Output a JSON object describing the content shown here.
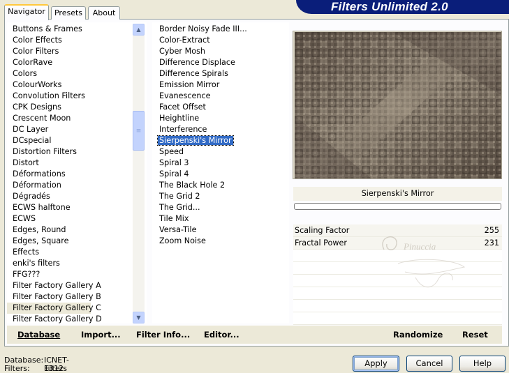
{
  "app": {
    "title": "Filters Unlimited 2.0"
  },
  "tabs": [
    {
      "label": "Navigator"
    },
    {
      "label": "Presets"
    },
    {
      "label": "About"
    }
  ],
  "categories": [
    "Buttons & Frames",
    "Color Effects",
    "Color Filters",
    "ColorRave",
    "Colors",
    "ColourWorks",
    "Convolution Filters",
    "CPK Designs",
    "Crescent Moon",
    "DC Layer",
    "DCspecial",
    "Distortion Filters",
    "Distort",
    "Déformations",
    "Déformation",
    "Dégradés",
    "ECWS halftone",
    "ECWS",
    "Edges, Round",
    "Edges, Square",
    "Effects",
    "enki's filters",
    "FFG???",
    "Filter Factory Gallery A",
    "Filter Factory Gallery B",
    "Filter Factory Gallery C",
    "Filter Factory Gallery D"
  ],
  "selected_category": "Filter Factory Gallery C",
  "filters": [
    "Border Noisy Fade III...",
    "Color-Extract",
    "Cyber Mosh",
    "Difference Displace",
    "Difference Spirals",
    "Emission Mirror",
    "Evanescence",
    "Facet Offset",
    "Heightline",
    "Interference",
    "Sierpenski's Mirror",
    "Speed",
    "Spiral 3",
    "Spiral 4",
    "The Black Hole 2",
    "The Grid 2",
    "The Grid...",
    "Tile Mix",
    "Versa-Tile",
    "Zoom Noise"
  ],
  "selected_filter": "Sierpenski's Mirror",
  "preview": {
    "filter_name": "Sierpenski's Mirror",
    "progress": 0
  },
  "params": [
    {
      "name": "Scaling Factor",
      "value": "255"
    },
    {
      "name": "Fractal Power",
      "value": "231"
    }
  ],
  "watermark": {
    "text": "Pinuccia"
  },
  "bottom_buttons": {
    "database": "Database",
    "import": "Import...",
    "filter_info": "Filter Info...",
    "editor": "Editor...",
    "randomize": "Randomize",
    "reset": "Reset"
  },
  "status": {
    "database_label": "Database:",
    "database_value": "ICNET-Filters",
    "filters_label": "Filters:",
    "filters_value": "1312"
  },
  "dialog_buttons": {
    "apply": "Apply",
    "cancel": "Cancel",
    "help": "Help"
  },
  "colors": {
    "banner": "#0a1e7a",
    "selection": "#316ac5",
    "tab_highlight": "#ffc83c"
  }
}
